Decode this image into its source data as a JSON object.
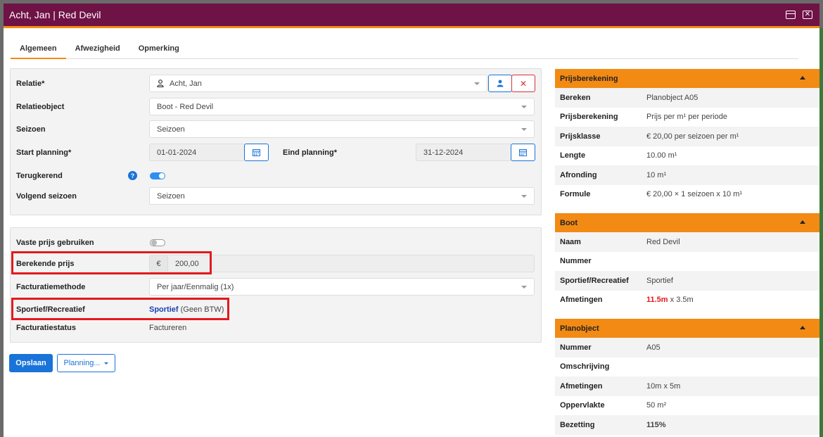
{
  "window": {
    "title": "Acht, Jan | Red Devil"
  },
  "tabs": [
    "Algemeen",
    "Afwezigheid",
    "Opmerking"
  ],
  "form": {
    "relatie_label": "Relatie*",
    "relatie_value": "Acht, Jan",
    "relatie_remove": "✕",
    "relatieobject_label": "Relatieobject",
    "relatieobject_value": "Boot - Red Devil",
    "seizoen_label": "Seizoen",
    "seizoen_value": "Seizoen",
    "start_label": "Start planning*",
    "start_value": "01-01-2024",
    "eind_label": "Eind planning*",
    "eind_value": "31-12-2024",
    "terugkerend_label": "Terugkerend",
    "terugkerend_on": true,
    "help_glyph": "?",
    "volgend_label": "Volgend seizoen",
    "volgend_value": "Seizoen"
  },
  "pricing": {
    "vaste_label": "Vaste prijs gebruiken",
    "vaste_on": false,
    "berekende_label": "Berekende prijs",
    "currency": "€",
    "berekende_value": "200,00",
    "facturatiemethode_label": "Facturatiemethode",
    "facturatiemethode_value": "Per jaar/Eenmalig (1x)",
    "sportief_label": "Sportief/Recreatief",
    "sportief_link": "Sportief",
    "sportief_suffix": "(Geen BTW)",
    "facturatiestatus_label": "Facturatiestatus",
    "facturatiestatus_value": "Factureren"
  },
  "buttons": {
    "save": "Opslaan",
    "planning": "Planning..."
  },
  "side": {
    "prijs": {
      "title": "Prijsberekening",
      "rows": [
        {
          "k": "Bereken",
          "v": "Planobject A05"
        },
        {
          "k": "Prijsberekening",
          "v": "Prijs per m¹ per periode"
        },
        {
          "k": "Prijsklasse",
          "v": "€ 20,00 per seizoen per m¹"
        },
        {
          "k": "Lengte",
          "v": "10.00 m¹"
        },
        {
          "k": "Afronding",
          "v": "10 m¹"
        },
        {
          "k": "Formule",
          "v": "€ 20,00 × 1 seizoen x 10 m¹"
        }
      ]
    },
    "boot": {
      "title": "Boot",
      "rows": [
        {
          "k": "Naam",
          "v": "Red Devil"
        },
        {
          "k": "Nummer",
          "v": ""
        },
        {
          "k": "Sportief/Recreatief",
          "v": "Sportief"
        }
      ],
      "afmetingen_label": "Afmetingen",
      "afmetingen_length": "11.5m",
      "afmetingen_rest": "x 3.5m"
    },
    "plan": {
      "title": "Planobject",
      "rows": [
        {
          "k": "Nummer",
          "v": "A05"
        },
        {
          "k": "Omschrijving",
          "v": ""
        },
        {
          "k": "Afmetingen",
          "v": "10m x 5m"
        },
        {
          "k": "Oppervlakte",
          "v": "50 m²"
        }
      ],
      "bezetting_label": "Bezetting",
      "bezetting_value": "115%"
    }
  },
  "colors": {
    "titlebar": "#6f1246",
    "accent": "#f28a14",
    "primary": "#1a73d9",
    "highlight": "#e3191f"
  }
}
